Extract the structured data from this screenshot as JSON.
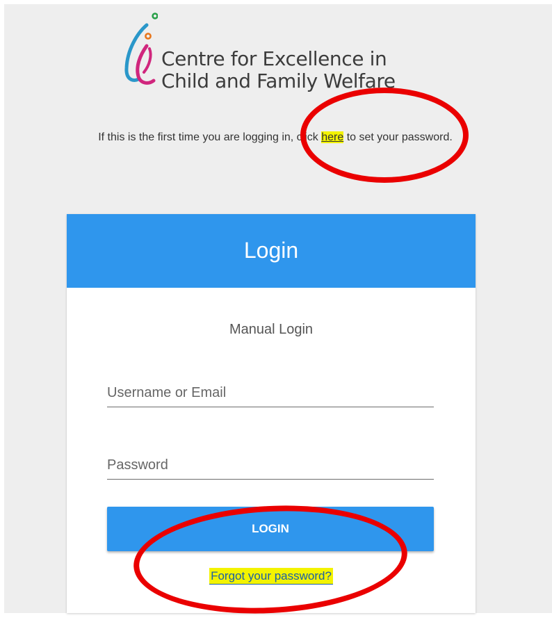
{
  "logo": {
    "line1": "Centre for Excellence in",
    "line2": "Child and Family Welfare",
    "colors": {
      "green": "#2aa14a",
      "orange": "#e8761c",
      "blue": "#2a66b3",
      "magenta": "#d0267d",
      "teal": "#2a97c9"
    }
  },
  "intro": {
    "before_link": "If this is the first time you are logging in, click ",
    "link_label": "here",
    "after_link": " to set your password."
  },
  "card": {
    "title": "Login",
    "subtitle": "Manual Login",
    "username_placeholder": "Username or Email",
    "password_placeholder": "Password",
    "login_button_label": "LOGIN",
    "forgot_link_label": "Forgot your password?"
  },
  "colors": {
    "primary": "#2f96ed",
    "highlight": "#f3f300",
    "annotation": "#ea0000",
    "background": "#eeeeee"
  }
}
